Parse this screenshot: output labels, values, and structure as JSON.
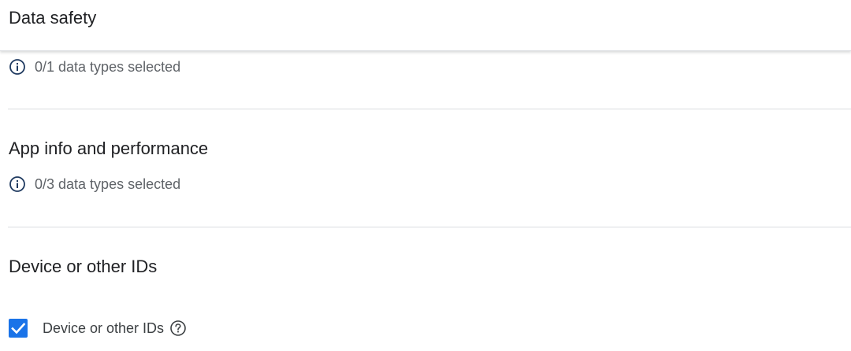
{
  "header": {
    "title": "Data safety"
  },
  "sections": [
    {
      "status": "0/1 data types selected",
      "status_icon": "info-icon"
    },
    {
      "title": "App info and performance",
      "status": "0/3 data types selected",
      "status_icon": "info-icon"
    },
    {
      "title": "Device or other IDs",
      "checkbox": {
        "label": "Device or other IDs",
        "checked": true,
        "help_icon": "help-icon"
      }
    }
  ],
  "colors": {
    "accent": "#1a73e8",
    "divider": "#dadce0",
    "text_primary": "#202124",
    "text_secondary": "#5f6368",
    "icon": "#1f3a60"
  }
}
